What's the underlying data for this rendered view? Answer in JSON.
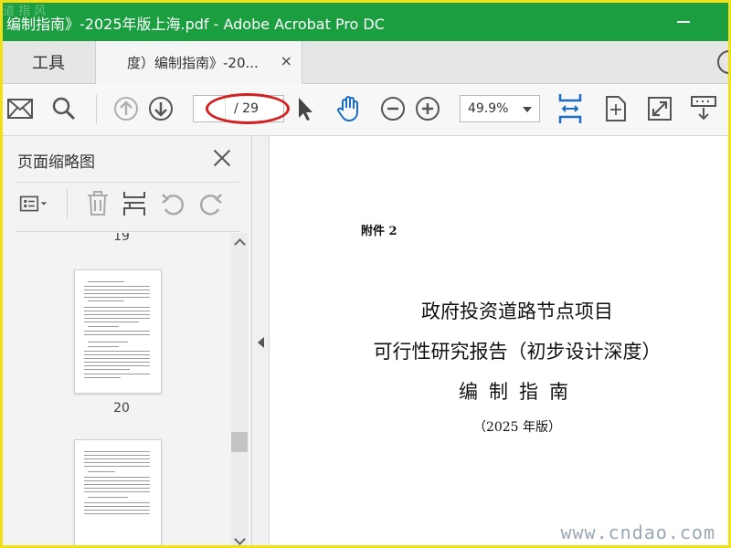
{
  "window": {
    "title": "编制指南》-2025年版上海.pdf - Adobe Acrobat Pro DC"
  },
  "tabs": {
    "tools_label": "工具",
    "doc_label": "度）编制指南》-20...",
    "close_glyph": "×"
  },
  "toolbar": {
    "page_current": "",
    "page_total": "/ 29",
    "zoom": "49.9%"
  },
  "panel": {
    "title": "页面缩略图",
    "pages": [
      {
        "num": "19"
      },
      {
        "num": "20"
      }
    ]
  },
  "document": {
    "appendix": "附件 2",
    "title_line1": "政府投资道路节点项目",
    "title_line2": "可行性研究报告（初步设计深度）",
    "title_line3": "编制指南",
    "version": "（2025 年版）"
  },
  "watermarks": {
    "bottom": "www.cndao.com"
  },
  "colors": {
    "titlebar": "#1a9e3f",
    "accent_blue": "#1a6fc4",
    "highlight_red": "#d42020",
    "frame_yellow": "#f0e01a"
  }
}
